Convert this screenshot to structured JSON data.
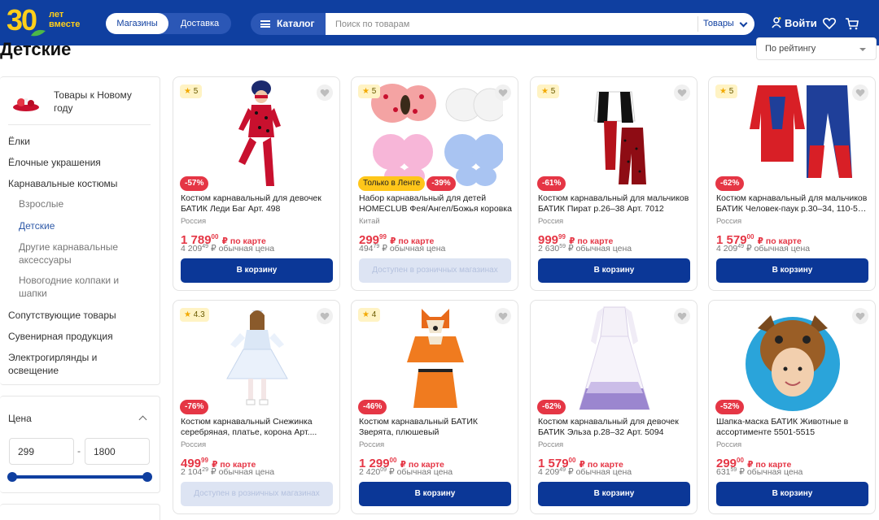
{
  "header": {
    "logo_number": "30",
    "logo_text": "лет вместе",
    "store_tabs": [
      "Магазины",
      "Доставка"
    ],
    "catalog_label": "Каталог",
    "search_placeholder": "Поиск по товарам",
    "search_scope": "Товары",
    "login_label": "Войти",
    "colors": {
      "brand": "#0f3fa0",
      "accent": "#ffcf1a",
      "discount": "#e53645"
    }
  },
  "page": {
    "title": "Детские",
    "sort_label": "По рейтингу"
  },
  "sidebar": {
    "promo_label": "Товары к Новому году",
    "items": [
      {
        "label": "Ёлки"
      },
      {
        "label": "Ёлочные украшения"
      },
      {
        "label": "Карнавальные костюмы"
      },
      {
        "label": "Взрослые"
      },
      {
        "label": "Детские"
      },
      {
        "label": "Другие карнавальные аксессуары"
      },
      {
        "label": "Новогодние колпаки и шапки"
      },
      {
        "label": "Сопутствующие товары"
      },
      {
        "label": "Сувенирная продукция"
      },
      {
        "label": "Электрогирлянды и освещение"
      }
    ],
    "price_filter": {
      "title": "Цена",
      "min": "299",
      "max": "1800",
      "dash": "-"
    }
  },
  "products": [
    {
      "rating": "5",
      "discount": "-57%",
      "name": "Костюм карнавальный для девочек БАТИК Леди Баг Арт. 498",
      "country": "Россия",
      "price_int": "1 789",
      "price_dec": "00",
      "price_suffix": "₽ по карте",
      "old_int": "4 209",
      "old_dec": "49",
      "old_suffix": "₽ обычная цена",
      "button": "В корзину"
    },
    {
      "rating": "5",
      "tag": "Только в Ленте",
      "discount": "-39%",
      "name": "Набор карнавальный для детей HOMECLUB Фея/Ангел/Божья коровка",
      "country": "Китай",
      "price_int": "299",
      "price_dec": "99",
      "price_suffix": "₽ по карте",
      "old_int": "494",
      "old_dec": "79",
      "old_suffix": "₽ обычная цена",
      "button": "Доступен в розничных магазинах"
    },
    {
      "rating": "5",
      "discount": "-61%",
      "name": "Костюм карнавальный для мальчиков БАТИК Пират р.26–38 Арт. 7012",
      "country": "Россия",
      "price_int": "999",
      "price_dec": "99",
      "price_suffix": "₽ по карте",
      "old_int": "2 630",
      "old_dec": "59",
      "old_suffix": "₽ обычная цена",
      "button": "В корзину"
    },
    {
      "rating": "5",
      "discount": "-62%",
      "name": "Костюм карнавальный для мальчиков БАТИК Человек-паук р.30–34, 110-5…",
      "country": "Россия",
      "price_int": "1 579",
      "price_dec": "00",
      "price_suffix": "₽ по карте",
      "old_int": "4 209",
      "old_dec": "49",
      "old_suffix": "₽ обычная цена",
      "button": "В корзину"
    },
    {
      "rating": "4.3",
      "discount": "-76%",
      "name": "Костюм карнавальный Снежинка серебряная, платье, корона Арт....",
      "country": "Россия",
      "price_int": "499",
      "price_dec": "99",
      "price_suffix": "₽ по карте",
      "old_int": "2 104",
      "old_dec": "29",
      "old_suffix": "₽ обычная цена",
      "button": "Доступен в розничных магазинах"
    },
    {
      "rating": "4",
      "discount": "-46%",
      "name": "Костюм карнавальный БАТИК Зверята, плюшевый",
      "country": "Россия",
      "price_int": "1 299",
      "price_dec": "00",
      "price_suffix": "₽ по карте",
      "old_int": "2 420",
      "old_dec": "09",
      "old_suffix": "₽ обычная цена",
      "button": "В корзину"
    },
    {
      "rating": "",
      "discount": "-62%",
      "name": "Костюм карнавальный для девочек БАТИК Эльза р.28–32 Арт. 5094",
      "country": "Россия",
      "price_int": "1 579",
      "price_dec": "00",
      "price_suffix": "₽ по карте",
      "old_int": "4 209",
      "old_dec": "49",
      "old_suffix": "₽ обычная цена",
      "button": "В корзину"
    },
    {
      "rating": "",
      "discount": "-52%",
      "name": "Шапка-маска БАТИК Животные в ассортименте 5501-5515",
      "country": "Россия",
      "price_int": "299",
      "price_dec": "00",
      "price_suffix": "₽ по карте",
      "old_int": "631",
      "old_dec": "59",
      "old_suffix": "₽ обычная цена",
      "button": "В корзину"
    }
  ]
}
